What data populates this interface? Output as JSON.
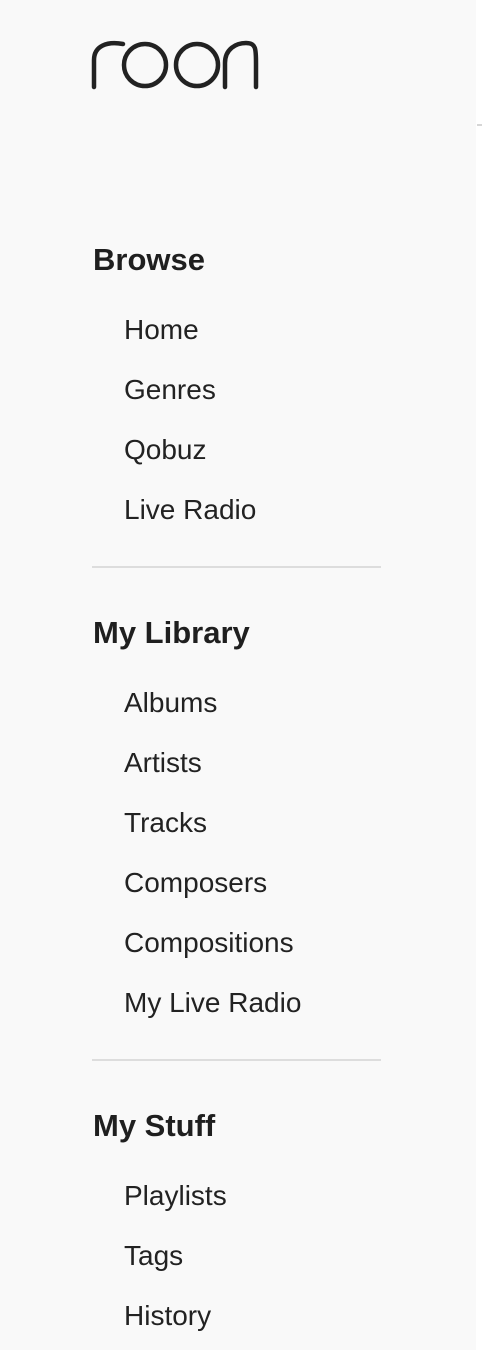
{
  "app": {
    "brand": "roon"
  },
  "sidebar": {
    "sections": [
      {
        "title": "Browse",
        "items": [
          {
            "label": "Home"
          },
          {
            "label": "Genres"
          },
          {
            "label": "Qobuz"
          },
          {
            "label": "Live Radio"
          }
        ]
      },
      {
        "title": "My Library",
        "items": [
          {
            "label": "Albums"
          },
          {
            "label": "Artists"
          },
          {
            "label": "Tracks"
          },
          {
            "label": "Composers"
          },
          {
            "label": "Compositions"
          },
          {
            "label": "My Live Radio"
          }
        ]
      },
      {
        "title": "My Stuff",
        "items": [
          {
            "label": "Playlists"
          },
          {
            "label": "Tags"
          },
          {
            "label": "History"
          }
        ]
      }
    ]
  },
  "colors": {
    "background": "#f9f9f9",
    "text": "#222222",
    "divider": "#dddddd"
  }
}
